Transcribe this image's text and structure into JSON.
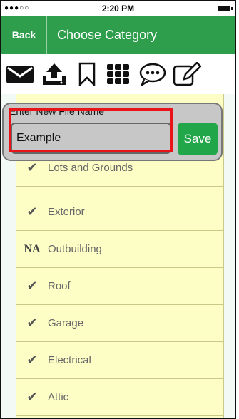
{
  "status_bar": {
    "signal": "●●●○○",
    "time": "2:20 PM"
  },
  "nav": {
    "back": "Back",
    "title": "Choose Category"
  },
  "toolbar": {
    "icons": [
      "envelope-icon",
      "upload-icon",
      "bookmark-icon",
      "grid-icon",
      "chat-icon",
      "edit-icon"
    ]
  },
  "popup": {
    "title": "Enter New File Name",
    "value": "Example",
    "save": "Save"
  },
  "list": {
    "items": [
      {
        "mark": "check",
        "label": "Lots and Grounds"
      },
      {
        "mark": "check",
        "label": "Exterior"
      },
      {
        "mark": "NA",
        "label": "Outbuilding"
      },
      {
        "mark": "check",
        "label": "Roof"
      },
      {
        "mark": "check",
        "label": "Garage"
      },
      {
        "mark": "check",
        "label": "Electrical"
      },
      {
        "mark": "check",
        "label": "Attic"
      }
    ]
  },
  "colors": {
    "accent": "#2e9e4d",
    "save": "#22a64a",
    "list_bg": "#fdfdc6",
    "highlight": "#e8141a"
  }
}
